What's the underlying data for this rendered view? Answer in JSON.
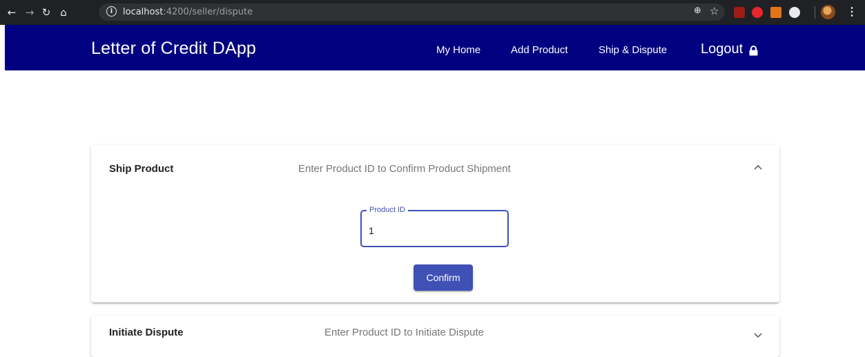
{
  "browser": {
    "url_host": "localhost",
    "url_path": ":4200/seller/dispute"
  },
  "app": {
    "brand": "Letter of Credit DApp",
    "nav": {
      "home": "My Home",
      "add_product": "Add Product",
      "ship_dispute": "Ship & Dispute",
      "logout": "Logout"
    }
  },
  "ship_panel": {
    "title": "Ship Product",
    "description": "Enter Product ID to Confirm Product Shipment",
    "field_label": "Product ID",
    "field_value": "1",
    "confirm_label": "Confirm",
    "expanded": true
  },
  "dispute_panel": {
    "title": "Initiate Dispute",
    "description": "Enter Product ID to Initiate Dispute",
    "expanded": false
  },
  "colors": {
    "appbar": "#000080",
    "primary": "#3f51b5"
  },
  "icons": {
    "back": "arrow-left-icon",
    "forward": "arrow-right-icon",
    "reload": "reload-icon",
    "home": "home-icon",
    "site_info": "info-icon",
    "zoom": "zoom-icon",
    "bookmark": "star-icon",
    "lock": "lock-icon",
    "collapse": "chevron-up-icon",
    "expand": "chevron-down-icon"
  }
}
